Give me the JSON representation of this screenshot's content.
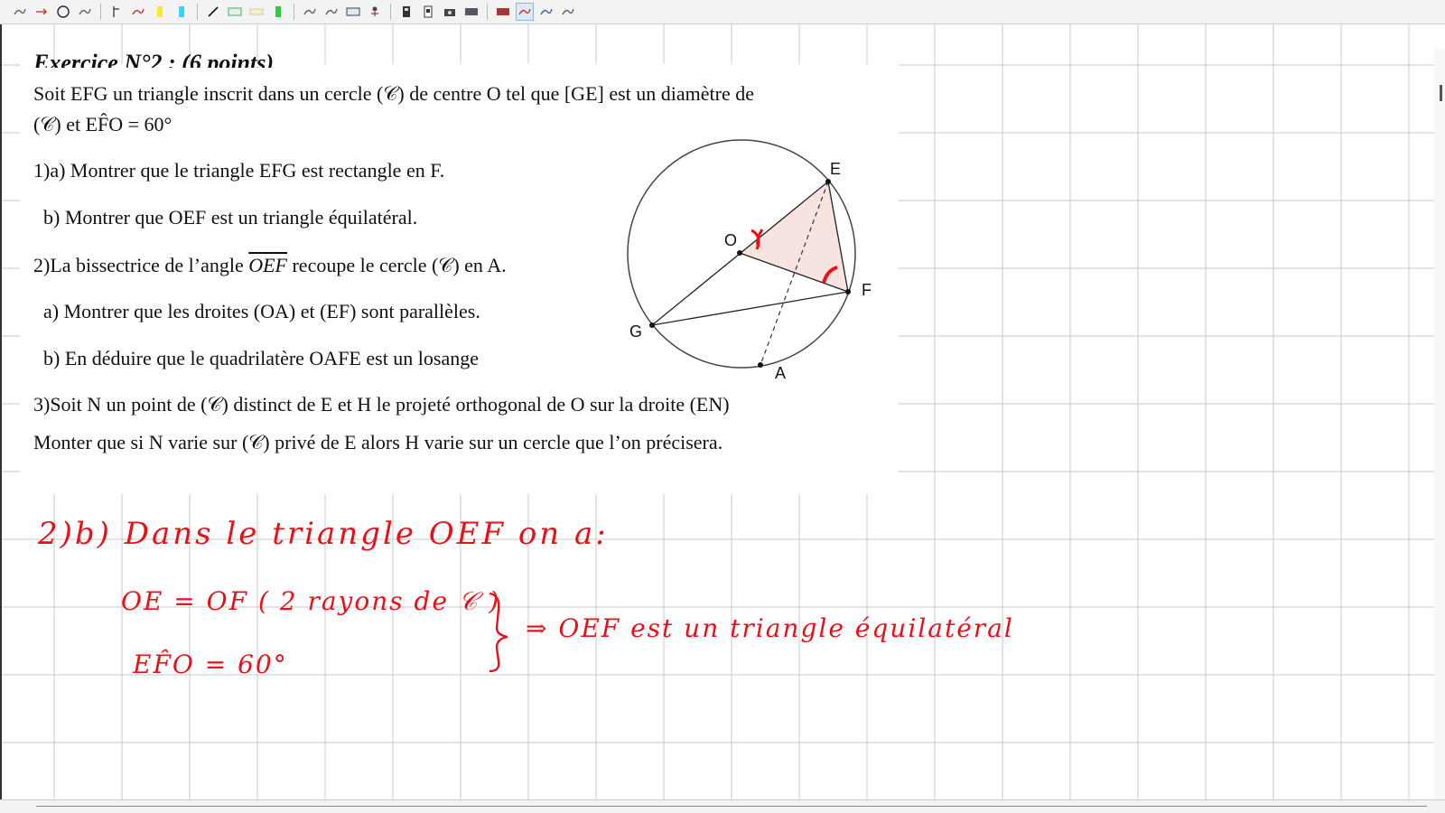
{
  "toolbar": {
    "tools": [
      "pen-icon",
      "arrow-icon",
      "circle-icon",
      "pen-icon",
      "text-cursor-icon",
      "pen-icon",
      "highlighter-yellow-icon",
      "highlighter-cyan-icon",
      "line-icon",
      "image-icon",
      "eraser-icon",
      "highlighter-green-icon",
      "pen-icon",
      "pen-icon",
      "image-icon",
      "figure-icon",
      "document-icon",
      "document-icon",
      "camera-icon",
      "picture-icon",
      "picture-icon",
      "pen-icon",
      "pen-icon",
      "pen-icon"
    ],
    "active_tool": "pen-icon"
  },
  "exercise": {
    "title_cut": "Exercice N°2 : (6 points)",
    "intro_1": "Soit EFG un triangle inscrit dans un cercle (𝒞) de centre O tel que [GE] est un diamètre de",
    "intro_2": "(𝒞) et EF̂O = 60°",
    "q1a": "1)a) Montrer que le triangle EFG est rectangle en F.",
    "q1b": "b) Montrer que  OEF est un triangle équilatéral.",
    "q2_before": "2)La bissectrice de l’angle ",
    "q2_angle": "OEF",
    "q2_after": " recoupe le cercle (𝒞) en A.",
    "q2a": "a) Montrer que  les droites (OA) et (EF) sont parallèles.",
    "q2b": "b) En déduire que le quadrilatère OAFE est un losange",
    "q3_1": "3)Soit N un point de (𝒞) distinct de E  et H le projeté orthogonal de O sur la droite (EN)",
    "q3_2": "Monter que si N varie sur (𝒞) privé de E alors H varie sur un cercle que l’on précisera."
  },
  "figure": {
    "points": {
      "E": "E",
      "O": "O",
      "F": "F",
      "G": "G",
      "A": "A"
    }
  },
  "handwriting": {
    "line1": "2)b) Dans le triangle OEF on a:",
    "line2": "OE = OF ( 2 rayons de 𝒞 )",
    "line3": "EF̂O = 60°",
    "conclusion": "⇒ OEF est un triangle équilatéral"
  },
  "colors": {
    "ink": "#e8111a",
    "grid": "#c8c8c8",
    "text": "#111111",
    "fill": "#f7e4e0"
  }
}
